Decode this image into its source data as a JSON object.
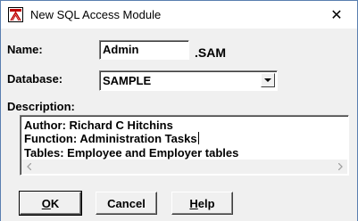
{
  "window": {
    "title": "New SQL Access Module",
    "close_glyph": "✕"
  },
  "form": {
    "name_label": "Name:",
    "name_value": "Admin",
    "name_suffix": ".SAM",
    "database_label": "Database:",
    "database_value": "SAMPLE",
    "description_label": "Description:",
    "description_lines": [
      "Author: Richard C Hitchins",
      "Function: Administration Tasks",
      "Tables: Employee and Employer tables"
    ]
  },
  "buttons": {
    "ok": {
      "mnemonic": "O",
      "rest": "K"
    },
    "cancel": "Cancel",
    "help": {
      "mnemonic": "H",
      "rest": "elp"
    }
  },
  "icons": {
    "app": "app-icon",
    "close": "close-icon",
    "dropdown": "chevron-down-icon",
    "scroll_left": "scroll-left-icon",
    "scroll_right": "scroll-right-icon"
  }
}
